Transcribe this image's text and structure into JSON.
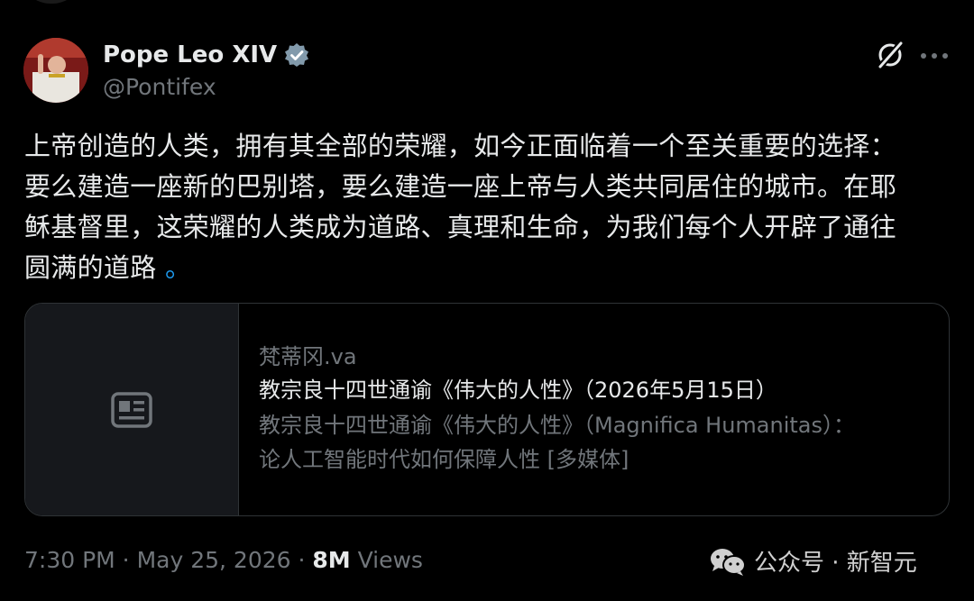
{
  "author": {
    "name": "Pope Leo XIV",
    "handle": "@Pontifex",
    "avatar_icon": "avatar-photo",
    "verified_icon": "verified-badge-icon"
  },
  "header_actions": {
    "grok_icon": "grok-icon",
    "more_icon": "more-icon"
  },
  "tweet": {
    "lines": [
      "上帝创造的人类，拥有其全部的荣耀，如今正面临着一个至关重要的选择：",
      "要么建造一座新的巴别塔，要么建造一座上帝与人类共同居住的城市。在耶",
      "稣基督里，这荣耀的人类成为道路、真理和生命，为我们每个人开辟了通往"
    ],
    "last_line": "圆满的道路",
    "link_glyph": "。"
  },
  "card": {
    "media_icon": "article-icon",
    "domain": "梵蒂冈.va",
    "title": "教宗良十四世通谕《伟大的人性》（2026年5月15日）",
    "description_lines": [
      "教宗良十四世通谕《伟大的人性》（Magnifica Humanitas）：",
      "论人工智能时代如何保障人性 [多媒体]"
    ]
  },
  "meta": {
    "timestamp": "7:30 PM · May 25, 2026 · ",
    "views_count": "8M",
    "views_label": " Views"
  },
  "watermark": {
    "icon": "wechat-icon",
    "text": "公众号 · 新智元"
  },
  "colors": {
    "background": "#000000",
    "text": "#e7e9ea",
    "secondary": "#71767b",
    "accent": "#1d9bf0",
    "border": "#2f3336"
  }
}
